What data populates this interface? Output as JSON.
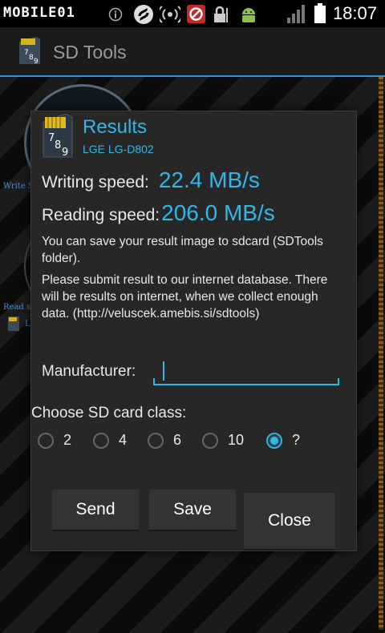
{
  "status_bar": {
    "watermark": "MOBILE01",
    "time": "18:07",
    "icons": [
      "gallery-icon",
      "info-icon",
      "sync-icon",
      "wifi-hotspot-icon",
      "block-icon",
      "lock-icon",
      "android-debug-icon",
      "signal-icon",
      "battery-icon"
    ]
  },
  "action_bar": {
    "title": "SD Tools"
  },
  "background": {
    "label_write": "Write S",
    "label_read": "Read sp",
    "label_l": "L"
  },
  "dialog": {
    "title": "Results",
    "subtitle": "LGE LG-D802",
    "writing_label": "Writing speed:",
    "writing_value": "22.4 MB/s",
    "reading_label": "Reading speed:",
    "reading_value": "206.0 MB/s",
    "info_save": "You can save your result image to sdcard (SDTools folder).",
    "info_submit": "Please submit result to our internet database. There will be results on internet, when we collect enough data. (http://veluscek.amebis.si/sdtools)",
    "manufacturer_label": "Manufacturer:",
    "manufacturer_value": "",
    "class_label": "Choose SD card class:",
    "classes": [
      {
        "label": "2",
        "checked": false
      },
      {
        "label": "4",
        "checked": false
      },
      {
        "label": "6",
        "checked": false
      },
      {
        "label": "10",
        "checked": false
      },
      {
        "label": "?",
        "checked": true
      }
    ],
    "buttons": {
      "send": "Send",
      "save": "Save",
      "close": "Close"
    }
  },
  "colors": {
    "accent": "#33b5e5",
    "dialog_bg": "#272727"
  }
}
